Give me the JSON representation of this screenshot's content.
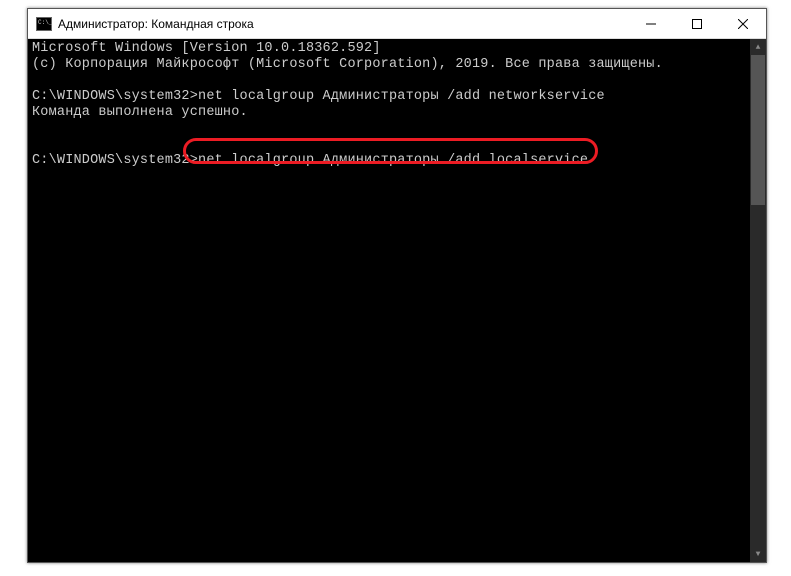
{
  "window": {
    "title": "Администратор: Командная строка"
  },
  "terminal": {
    "line1": "Microsoft Windows [Version 10.0.18362.592]",
    "line2": "(c) Корпорация Майкрософт (Microsoft Corporation), 2019. Все права защищены.",
    "blank1": "",
    "prompt1": "C:\\WINDOWS\\system32>",
    "cmd1": "net localgroup Администраторы /add networkservice",
    "result1": "Команда выполнена успешно.",
    "blank2": "",
    "blank3": "",
    "prompt2": "C:\\WINDOWS\\system32>",
    "cmd2": "net localgroup Администраторы /add localservice"
  },
  "highlight": {
    "color": "#ec1c24"
  }
}
